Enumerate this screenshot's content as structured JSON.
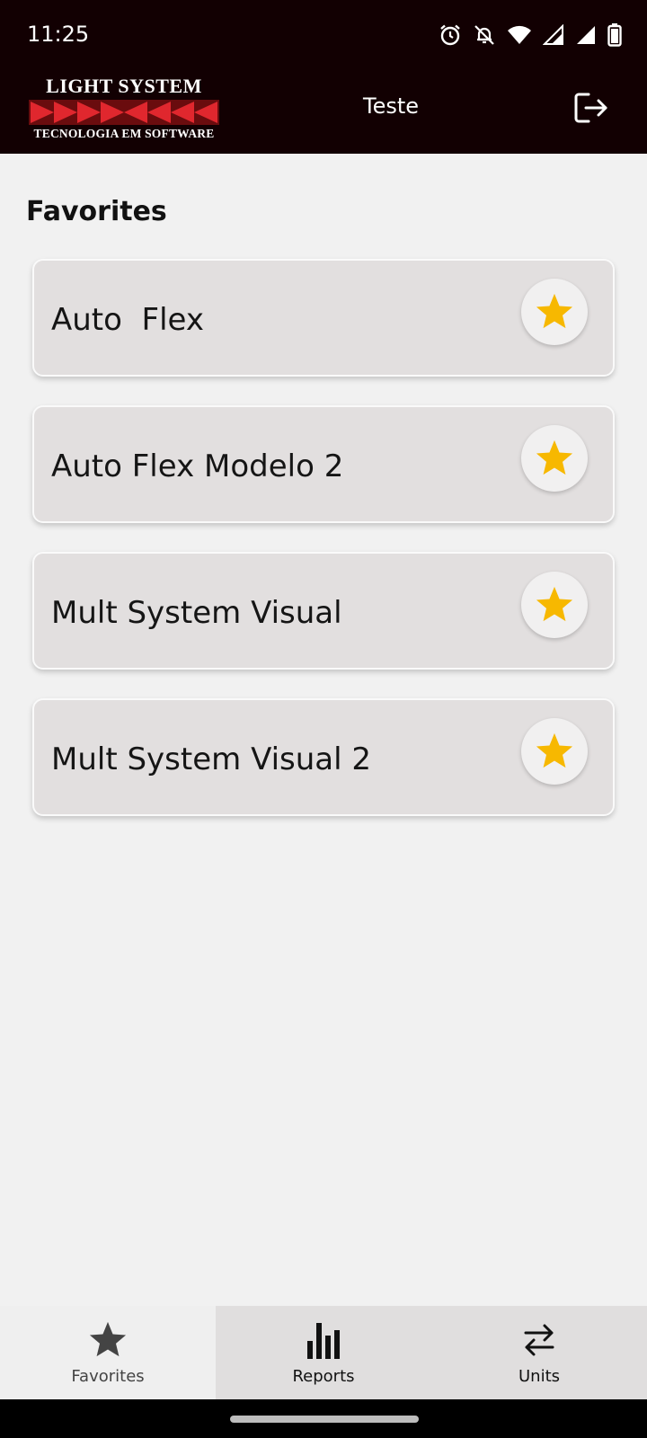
{
  "status_bar": {
    "time": "11:25",
    "icons": [
      "alarm-icon",
      "notifications-off-icon",
      "wifi-icon",
      "signal-icon",
      "signal-icon",
      "battery-icon"
    ]
  },
  "header": {
    "logo_top": "LIGHT SYSTEM",
    "logo_bottom": "TECNOLOGIA EM SOFTWARE",
    "title": "Teste",
    "logout_icon": "logout-icon"
  },
  "favorites": {
    "section_title": "Favorites",
    "items": [
      {
        "name": "Auto  Flex",
        "starred": true
      },
      {
        "name": "Auto Flex Modelo 2",
        "starred": true
      },
      {
        "name": "Mult System Visual",
        "starred": true
      },
      {
        "name": "Mult System Visual 2",
        "starred": true
      }
    ]
  },
  "bottom_nav": {
    "items": [
      {
        "label": "Favorites",
        "icon": "star-icon",
        "active": true
      },
      {
        "label": "Reports",
        "icon": "bar-chart-icon",
        "active": false
      },
      {
        "label": "Units",
        "icon": "swap-arrows-icon",
        "active": false
      }
    ]
  },
  "colors": {
    "header_bg": "#120002",
    "star": "#f7b800",
    "card_bg": "#e2dfdf",
    "logo_red": "#e0272e"
  }
}
